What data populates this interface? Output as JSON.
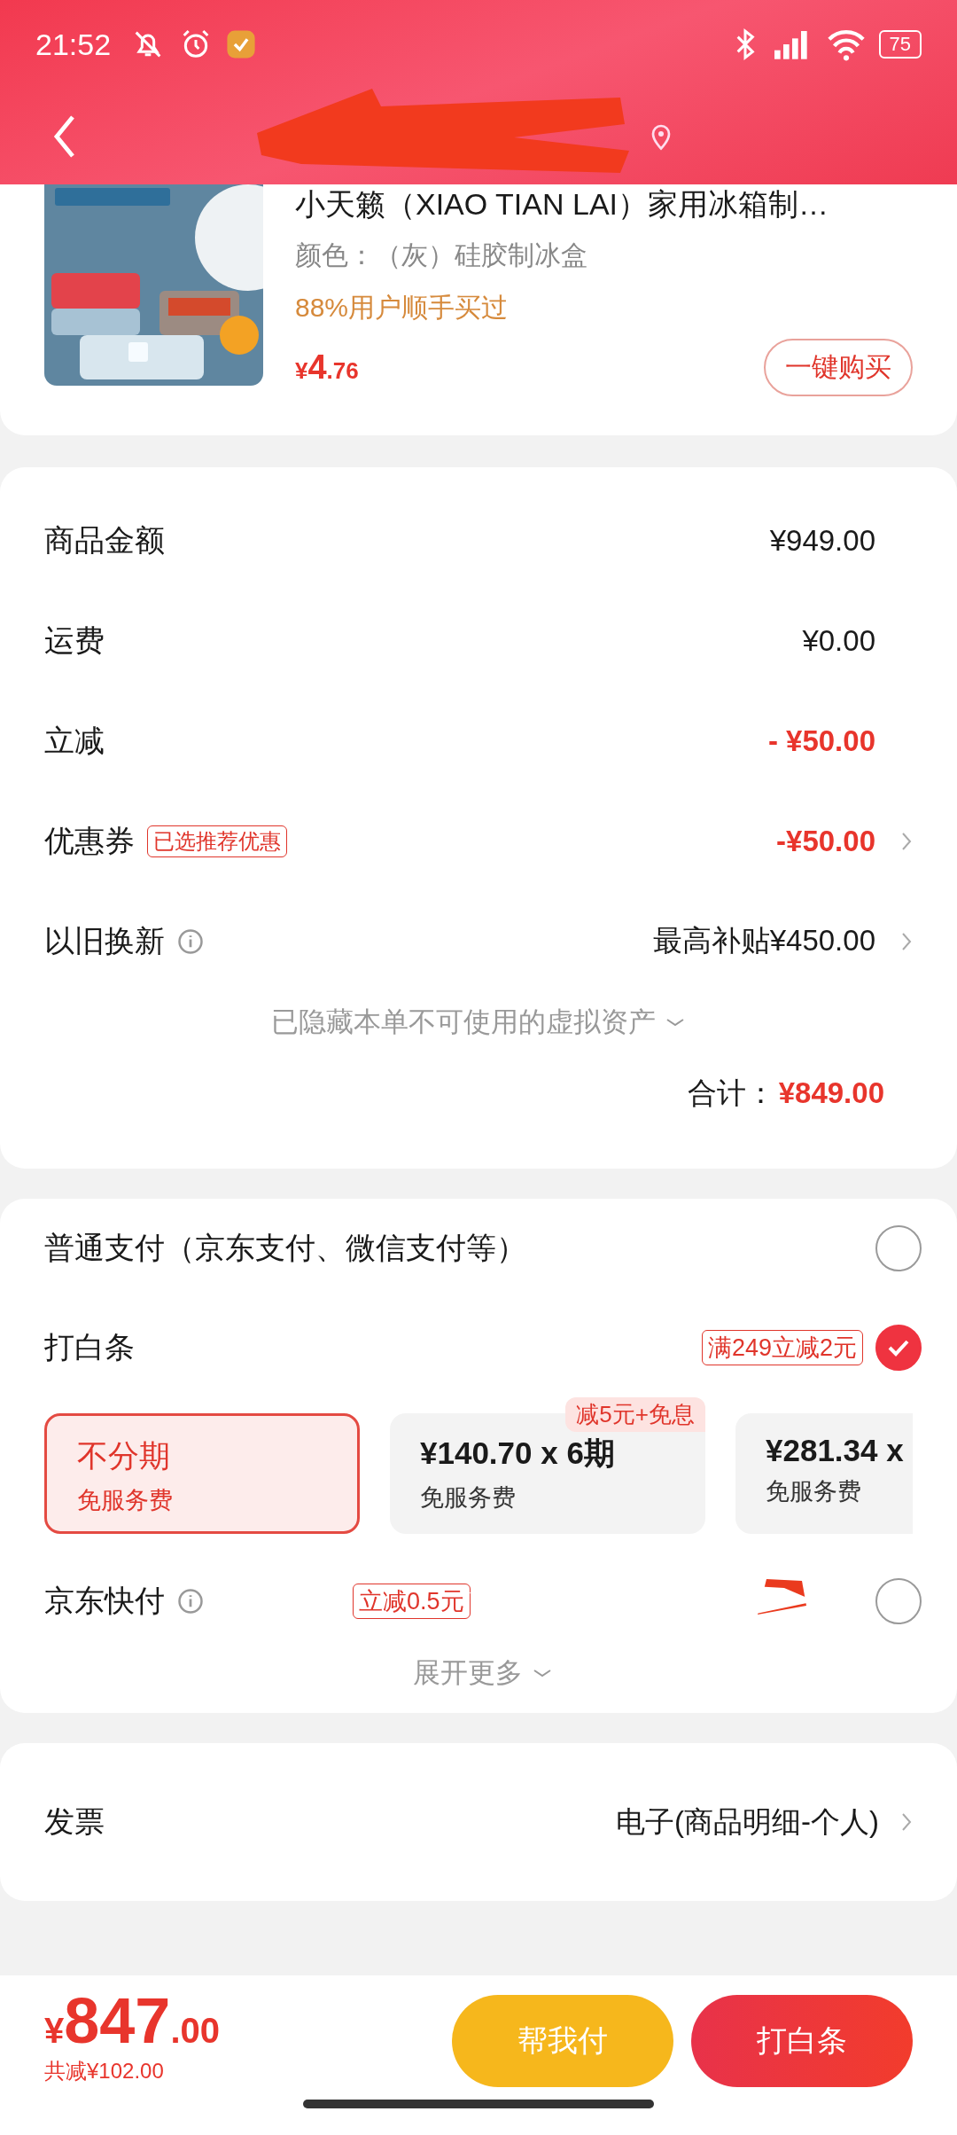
{
  "status_bar": {
    "time": "21:52",
    "battery": "75"
  },
  "product": {
    "title": "小天籁（XIAO TIAN LAI）家用冰箱制…",
    "variant": "颜色：（灰）硅胶制冰盒",
    "social_proof": "88%用户顺手买过",
    "price_symbol": "¥",
    "price_integer": "4",
    "price_decimal": ".76",
    "buy_button": "一键购买"
  },
  "summary": {
    "rows": [
      {
        "label": "商品金额",
        "value": "¥949.00",
        "kind": "plain"
      },
      {
        "label": "运费",
        "value": "¥0.00",
        "kind": "plain"
      },
      {
        "label": "立减",
        "value": "- ¥50.00",
        "kind": "discount"
      },
      {
        "label": "优惠券",
        "tag": "已选推荐优惠",
        "value": "-¥50.00",
        "kind": "discount",
        "chevron": true
      },
      {
        "label": "以旧换新",
        "value": "最高补贴¥450.00",
        "kind": "plain",
        "chevron": true,
        "info": true
      }
    ],
    "hidden_note": "已隐藏本单不可使用的虚拟资产",
    "total_label": "合计：",
    "total": "¥849.00"
  },
  "payment": {
    "methods": [
      {
        "label": "普通支付（京东支付、微信支付等）",
        "selected": false
      },
      {
        "label": "打白条",
        "tag": "满249立减2元",
        "selected": true,
        "plans": [
          {
            "title": "不分期",
            "subtitle": "免服务费",
            "selected": true
          },
          {
            "title": "¥140.70 x 6期",
            "subtitle": "免服务费",
            "badge": "减5元+免息",
            "selected": false
          },
          {
            "title": "¥281.34 x",
            "subtitle": "免服务费",
            "selected": false
          }
        ]
      },
      {
        "label": "京东快付",
        "info": true,
        "tag": "立减0.5元",
        "redacted": true,
        "selected": false
      }
    ],
    "expand": "展开更多"
  },
  "invoice": {
    "label": "发票",
    "value": "电子(商品明细-个人)"
  },
  "bottom_bar": {
    "price_symbol": "¥",
    "price_integer": "847",
    "price_decimal": ".00",
    "saved": "共减¥102.00",
    "buttons": [
      {
        "label": "帮我付",
        "kind": "secondary"
      },
      {
        "label": "打白条",
        "kind": "primary"
      }
    ]
  }
}
